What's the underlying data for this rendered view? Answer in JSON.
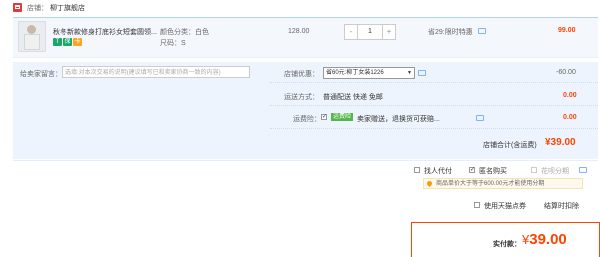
{
  "shop": {
    "prefix": "店铺：",
    "name": "柳丁旗舰店",
    "logo_icon": "shop-logo-icon"
  },
  "item": {
    "title": "秋冬新款修身打底衫女短套圆领...",
    "badges": [
      {
        "icon": "tmall-badge-icon",
        "text": "T",
        "color": "#19a869"
      },
      {
        "icon": "guarantee-badge-icon",
        "text": "保",
        "color": "#19a869"
      },
      {
        "icon": "card-badge-icon",
        "text": "卡",
        "color": "#f5a623"
      }
    ],
    "color_label": "颜色分类：白色",
    "size_label": "尺码：S",
    "price": "128.00",
    "quantity": "1",
    "minus": "-",
    "plus": "+",
    "promo": "省29:限时特惠",
    "total": "99.00"
  },
  "options": {
    "message_label": "给卖家留言：",
    "message_placeholder": "选填:对本次交易的说明(建议填写已和卖家协商一致的内容)",
    "coupon_label": "店铺优惠：",
    "coupon_selected": "省60元:柳丁女装1226",
    "coupon_amount": "-60.00",
    "shipping_label": "运送方式：",
    "shipping_value": "普通配送 快递 免邮",
    "shipping_amount": "0.00",
    "insurance_label": "运费险：",
    "insurance_tag": "运费险",
    "insurance_text": "卖家赠送，退换货可获赔...",
    "insurance_amount": "0.00",
    "shop_total_label": "店铺合计(含运费)",
    "shop_total": "¥39.00"
  },
  "bottom": {
    "pay_for_other": "找人代付",
    "anonymous": "匿名购买",
    "installment": "花呗分期",
    "installment_notice": "商品单价大于等于600.00元才能使用分期",
    "tmall_points": "使用天猫点券",
    "checkout_deduct": "结算时扣除",
    "final_label": "实付款：",
    "final_currency": "¥",
    "final_amount": "39.00"
  },
  "colors": {
    "accent": "#ff4400",
    "row_bg": "#f4f8fd",
    "options_bg": "#eef4fd",
    "green": "#55b64a"
  }
}
